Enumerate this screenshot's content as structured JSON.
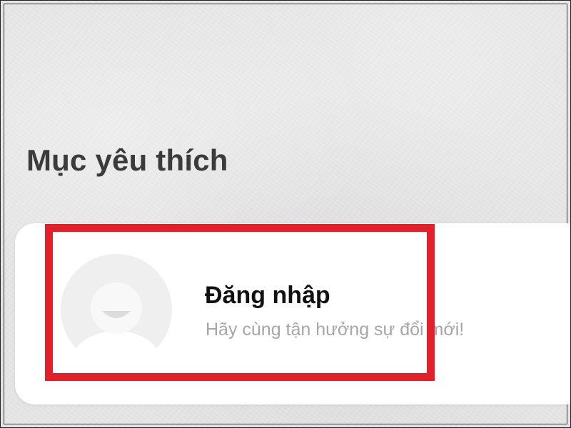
{
  "favorites": {
    "title": "Mục yêu thích"
  },
  "login_card": {
    "avatar_icon": "default-user-avatar-icon",
    "title": "Đăng nhập",
    "subtitle": "Hãy cùng tận hưởng sự đổi mới!"
  },
  "annotation": {
    "color": "#e3202a"
  }
}
